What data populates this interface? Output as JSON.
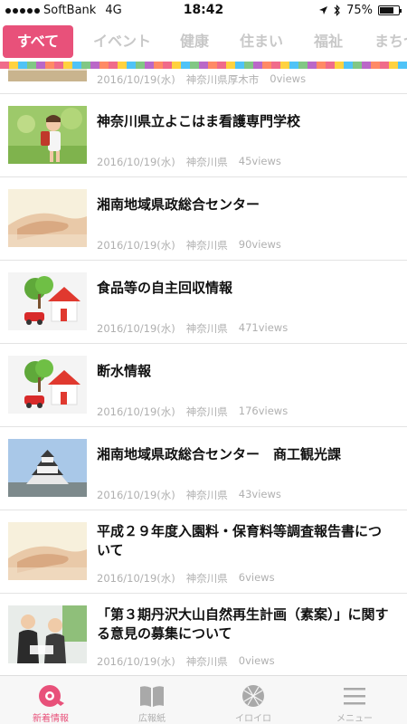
{
  "status_bar": {
    "carrier": "SoftBank",
    "network": "4G",
    "time": "18:42",
    "battery": "75%",
    "battery_level": 0.75
  },
  "category_tabs": [
    {
      "label": "すべて",
      "active": true
    },
    {
      "label": "イベント",
      "active": false
    },
    {
      "label": "健康",
      "active": false
    },
    {
      "label": "住まい",
      "active": false
    },
    {
      "label": "福祉",
      "active": false
    },
    {
      "label": "まちづ",
      "active": false
    }
  ],
  "stripe_colors": [
    "#f06b8a",
    "#ffd23f",
    "#4fc3f7",
    "#81c784",
    "#ba68c8",
    "#ff8a65",
    "#f06b8a",
    "#ffd23f",
    "#4fc3f7",
    "#81c784",
    "#ba68c8",
    "#ff8a65",
    "#f06b8a",
    "#ffd23f",
    "#4fc3f7",
    "#81c784",
    "#ba68c8",
    "#ff8a65",
    "#f06b8a",
    "#ffd23f",
    "#4fc3f7",
    "#81c784",
    "#ba68c8",
    "#ff8a65",
    "#f06b8a",
    "#ffd23f",
    "#4fc3f7",
    "#81c784",
    "#ba68c8",
    "#ff8a65",
    "#f06b8a",
    "#ffd23f",
    "#4fc3f7",
    "#81c784",
    "#ba68c8",
    "#ff8a65",
    "#f06b8a",
    "#ffd23f",
    "#4fc3f7",
    "#81c784",
    "#ba68c8",
    "#ff8a65",
    "#f06b8a",
    "#ffd23f",
    "#4fc3f7"
  ],
  "articles": [
    {
      "title": "",
      "date": "2016/10/19(水)",
      "location": "神奈川県厚木市",
      "views": "0views",
      "thumb": "partial-image"
    },
    {
      "title": "神奈川県立よこはま看護専門学校",
      "date": "2016/10/19(水)",
      "location": "神奈川県",
      "views": "45views",
      "thumb": "child-with-backpack-image"
    },
    {
      "title": "湘南地域県政総合センター",
      "date": "2016/10/19(水)",
      "location": "神奈川県",
      "views": "90views",
      "thumb": "holding-hands-image"
    },
    {
      "title": "食品等の自主回収情報",
      "date": "2016/10/19(水)",
      "location": "神奈川県",
      "views": "471views",
      "thumb": "house-and-tree-image"
    },
    {
      "title": "断水情報",
      "date": "2016/10/19(水)",
      "location": "神奈川県",
      "views": "176views",
      "thumb": "house-and-tree-image"
    },
    {
      "title": "湘南地域県政総合センター　商工観光課",
      "date": "2016/10/19(水)",
      "location": "神奈川県",
      "views": "43views",
      "thumb": "castle-image"
    },
    {
      "title": "平成２９年度入園料・保育料等調査報告書について",
      "date": "2016/10/19(水)",
      "location": "神奈川県",
      "views": "6views",
      "thumb": "holding-hands-image"
    },
    {
      "title": "「第３期丹沢大山自然再生計画（素案）」に関する意見の募集について",
      "date": "2016/10/19(水)",
      "location": "神奈川県",
      "views": "0views",
      "thumb": "business-people-image"
    }
  ],
  "tab_bar": [
    {
      "label": "新着情報",
      "icon": "new-info-icon",
      "active": true
    },
    {
      "label": "広報紙",
      "icon": "book-icon",
      "active": false
    },
    {
      "label": "イロイロ",
      "icon": "globe-icon",
      "active": false
    },
    {
      "label": "メニュー",
      "icon": "menu-icon",
      "active": false
    }
  ],
  "colors": {
    "accent": "#e8517a",
    "inactive_tab": "#c8c8c8",
    "meta_text": "#b0b0b0"
  }
}
